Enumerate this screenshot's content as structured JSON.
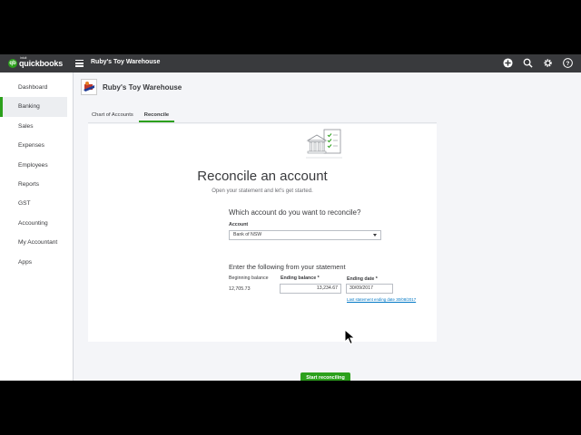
{
  "brand": {
    "intuit": "intuit",
    "name": "quickbooks",
    "logo_letters": "qb",
    "accent": "#2ca01c"
  },
  "header": {
    "company": "Ruby's Toy Warehouse"
  },
  "sidebar": {
    "items": [
      {
        "label": "Dashboard"
      },
      {
        "label": "Banking",
        "active": true
      },
      {
        "label": "Sales"
      },
      {
        "label": "Expenses"
      },
      {
        "label": "Employees"
      },
      {
        "label": "Reports"
      },
      {
        "label": "GST"
      },
      {
        "label": "Accounting"
      },
      {
        "label": "My Accountant"
      },
      {
        "label": "Apps"
      }
    ]
  },
  "main": {
    "company_name": "Ruby's Toy Warehouse",
    "tabs": [
      {
        "label": "Chart of Accounts"
      },
      {
        "label": "Reconcile",
        "active": true
      }
    ],
    "reconcile": {
      "title": "Reconcile an account",
      "subtitle": "Open your statement and let's get started.",
      "question": "Which account do you want to reconcile?",
      "account_label": "Account",
      "account_value": "Bank of NSW",
      "statement_heading": "Enter the following from your statement",
      "beginning_label": "Beginning balance",
      "beginning_value": "12,705.73",
      "ending_balance_label": "Ending balance *",
      "ending_balance_value": "13,234.67",
      "ending_date_label": "Ending date *",
      "ending_date_value": "30/09/2017",
      "last_statement": "Last statement ending date 30/08/2017",
      "start_button": "Start reconciling"
    }
  }
}
